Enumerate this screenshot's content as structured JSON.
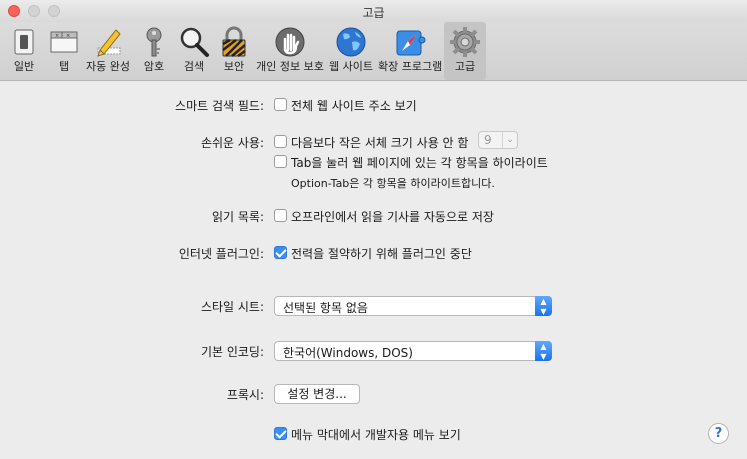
{
  "window": {
    "title": "고급"
  },
  "toolbar": {
    "items": [
      {
        "label": "일반"
      },
      {
        "label": "탭"
      },
      {
        "label": "자동 완성"
      },
      {
        "label": "암호"
      },
      {
        "label": "검색"
      },
      {
        "label": "보안"
      },
      {
        "label": "개인 정보 보호"
      },
      {
        "label": "웹 사이트"
      },
      {
        "label": "확장 프로그램"
      },
      {
        "label": "고급"
      }
    ],
    "active": "고급"
  },
  "smart_search": {
    "label": "스마트 검색 필드:",
    "option": "전체 웹 사이트 주소 보기",
    "checked": false
  },
  "accessibility": {
    "label": "손쉬운 사용:",
    "option1": "다음보다 작은 서체 크기 사용 안 함",
    "font_size": "9",
    "option2": "Tab을 눌러 웹 페이지에 있는 각 항목을 하이라이트",
    "hint": "Option-Tab은 각 항목을 하이라이트합니다.",
    "checked1": false,
    "checked2": false
  },
  "reading_list": {
    "label": "읽기 목록:",
    "option": "오프라인에서 읽을 기사를 자동으로 저장",
    "checked": false
  },
  "plugins": {
    "label": "인터넷 플러그인:",
    "option": "전력을 절약하기 위해 플러그인 중단",
    "checked": true
  },
  "style_sheet": {
    "label": "스타일 시트:",
    "value": "선택된 항목 없음"
  },
  "encoding": {
    "label": "기본 인코딩:",
    "value": "한국어(Windows, DOS)"
  },
  "proxy": {
    "label": "프록시:",
    "button": "설정 변경..."
  },
  "develop_menu": {
    "option": "메뉴 막대에서 개발자용 메뉴 보기",
    "checked": true
  },
  "help": {
    "label": "?"
  },
  "colors": {
    "accent": "#3b8df7",
    "close": "#fc605c"
  }
}
